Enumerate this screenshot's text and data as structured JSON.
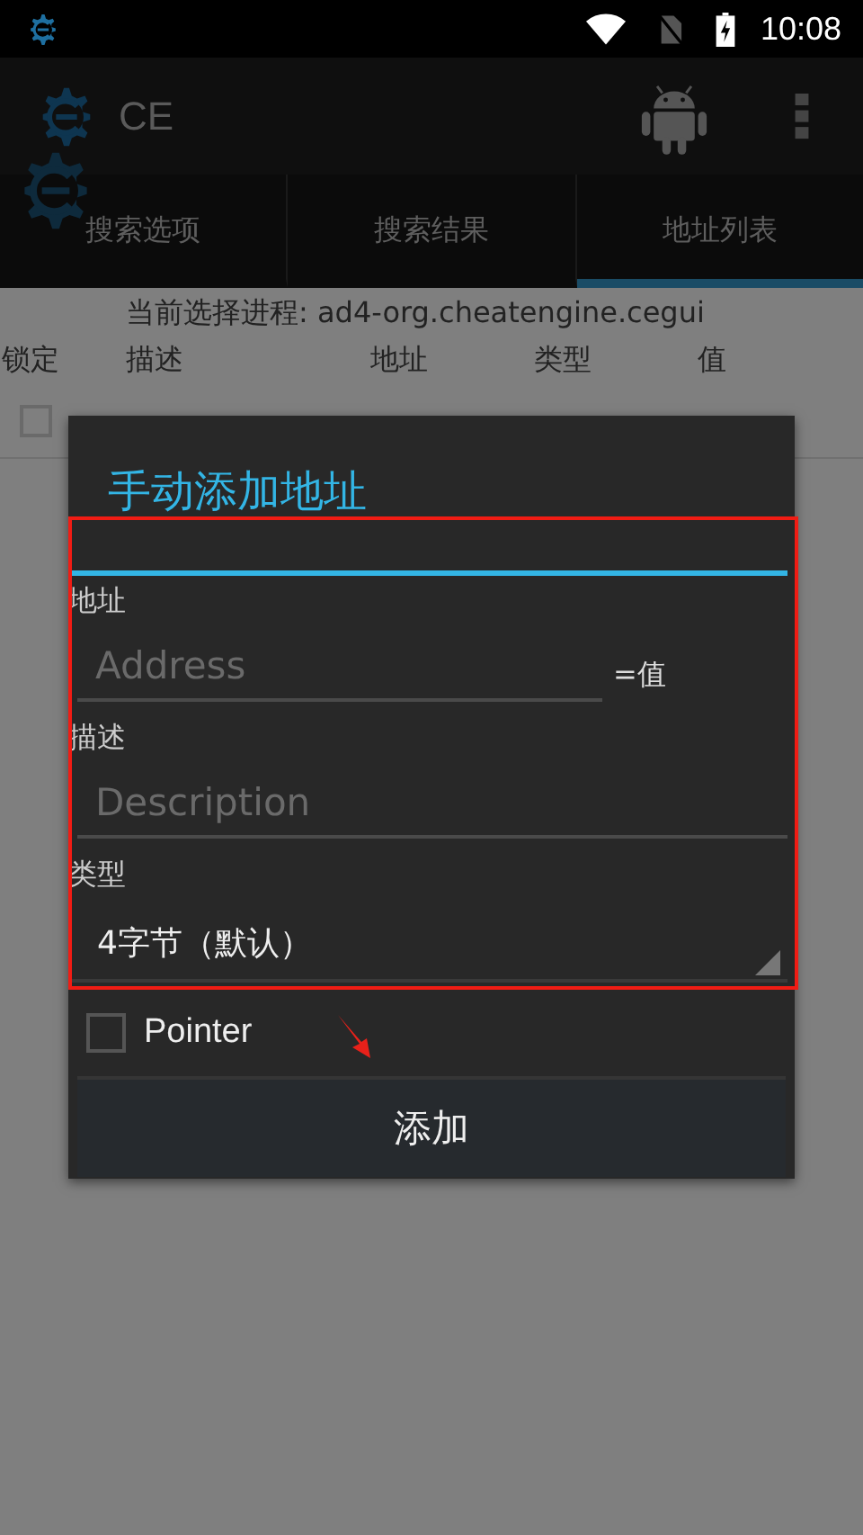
{
  "status_bar": {
    "time": "10:08"
  },
  "action_bar": {
    "title": "CE"
  },
  "tabs": [
    {
      "label": "搜索选项",
      "selected": false
    },
    {
      "label": "搜索结果",
      "selected": false
    },
    {
      "label": "地址列表",
      "selected": true
    }
  ],
  "process_label": "当前选择进程: ad4-org.cheatengine.cegui",
  "table": {
    "columns": [
      "锁定",
      "描述",
      "地址",
      "类型",
      "值"
    ],
    "rows": [
      {
        "locked": false
      }
    ]
  },
  "dialog": {
    "title": "手动添加地址",
    "fields": [
      {
        "label": "地址",
        "placeholder": "Address",
        "suffix": "=值"
      },
      {
        "label": "描述",
        "placeholder": "Description"
      }
    ],
    "type": {
      "label": "类型",
      "value": "4字节（默认）"
    },
    "pointer": {
      "label": "Pointer",
      "checked": false
    },
    "button": "添加"
  }
}
